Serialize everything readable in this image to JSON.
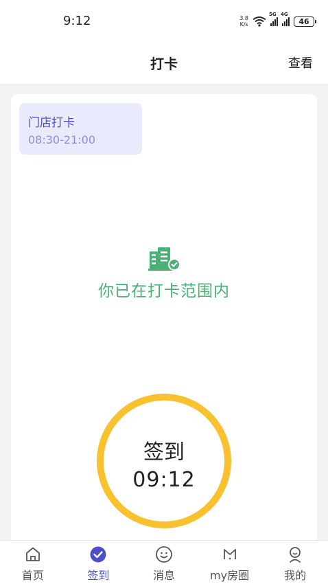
{
  "status_bar": {
    "time": "9:12",
    "net_speed_value": "3.8",
    "net_speed_unit": "K/s",
    "sim1_network": "5G",
    "sim2_network": "4G",
    "battery": "46",
    "icons": [
      "wifi-icon",
      "signal-5g-icon",
      "signal-4g-icon",
      "battery-icon"
    ]
  },
  "header": {
    "title": "打卡",
    "action_label": "查看"
  },
  "shift": {
    "name": "门店打卡",
    "hours": "08:30-21:00"
  },
  "range_status": {
    "icon": "building-check-icon",
    "text": "你已在打卡范围内",
    "color": "#4caf78"
  },
  "clock_button": {
    "label": "签到",
    "time": "09:12",
    "ring_color": "#f7c130"
  },
  "bottom_nav": {
    "active_color": "#4a4fc7",
    "items": [
      {
        "label": "首页",
        "icon": "home-icon",
        "active": false
      },
      {
        "label": "签到",
        "icon": "check-circle-icon",
        "active": true
      },
      {
        "label": "消息",
        "icon": "smiley-message-icon",
        "active": false
      },
      {
        "label": "my房圈",
        "icon": "m-circle-icon",
        "active": false
      },
      {
        "label": "我的",
        "icon": "user-icon",
        "active": false
      }
    ]
  }
}
